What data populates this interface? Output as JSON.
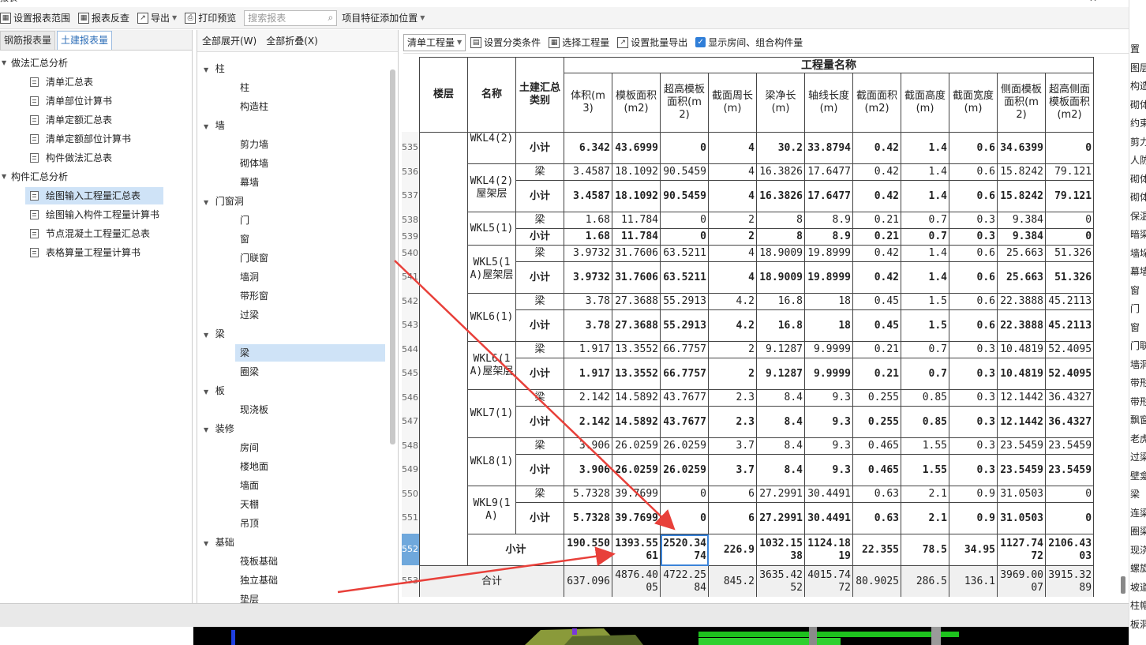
{
  "window": {
    "title": "报表",
    "close_glyph": "✕"
  },
  "toolbar": {
    "items": [
      "设置报表范围",
      "报表反查",
      "导出",
      "打印预览"
    ],
    "search_placeholder": "搜索报表",
    "item_after_search": "项目特征添加位置"
  },
  "left_panel": {
    "tabs": [
      "钢筋报表量",
      "土建报表量"
    ],
    "active_tab": 1,
    "groups": [
      {
        "label": "做法汇总分析",
        "items": [
          "清单汇总表",
          "清单部位计算书",
          "清单定额汇总表",
          "清单定额部位计算书",
          "构件做法汇总表"
        ]
      },
      {
        "label": "构件汇总分析",
        "items": [
          "绘图输入工程量汇总表",
          "绘图输入构件工程量计算书",
          "节点混凝土工程量汇总表",
          "表格算量工程量计算书"
        ]
      }
    ],
    "selected_item": "绘图输入工程量汇总表"
  },
  "mid_panel": {
    "expand_all": "全部展开(W)",
    "collapse_all": "全部折叠(X)",
    "tree": [
      {
        "label": "柱",
        "children": [
          "柱",
          "构造柱"
        ]
      },
      {
        "label": "墙",
        "children": [
          "剪力墙",
          "砌体墙",
          "幕墙"
        ]
      },
      {
        "label": "门窗洞",
        "children": [
          "门",
          "窗",
          "门联窗",
          "墙洞",
          "带形窗",
          "过梁"
        ]
      },
      {
        "label": "梁",
        "children": [
          "梁",
          "圈梁"
        ]
      },
      {
        "label": "板",
        "children": [
          "现浇板"
        ]
      },
      {
        "label": "装修",
        "children": [
          "房间",
          "楼地面",
          "墙面",
          "天棚",
          "吊顶"
        ]
      },
      {
        "label": "基础",
        "children": [
          "筏板基础",
          "独立基础",
          "垫层"
        ]
      }
    ],
    "selected": "梁"
  },
  "report_toolbar": {
    "mode_select": "清单工程量",
    "buttons": [
      "设置分类条件",
      "选择工程量",
      "设置批量导出"
    ],
    "checkbox_label": "显示房间、组合构件量",
    "checkbox_checked": true
  },
  "table": {
    "group_header": "工程量名称",
    "fixed_headers": [
      "楼层",
      "名称",
      "土建汇总类别"
    ],
    "columns": [
      "体积(m3)",
      "模板面积(m2)",
      "超高模板面积(m2)",
      "截面周长(m)",
      "梁净长(m)",
      "轴线长度(m)",
      "截面面积(m2)",
      "截面高度(m)",
      "截面宽度(m)",
      "侧面模板面积(m2)",
      "超高侧面模板面积(m2)"
    ],
    "rows": [
      {
        "num": "535",
        "name": "WKL4(2)",
        "cat": "小计",
        "bold": true,
        "v": [
          "6.342",
          "43.6999",
          "0",
          "4",
          "30.2",
          "33.8794",
          "0.42",
          "1.4",
          "0.6",
          "34.6399",
          "0"
        ]
      },
      {
        "num": "536",
        "name": "WKL4(2)屋架层",
        "cat": "梁",
        "bold": false,
        "v": [
          "3.4587",
          "18.1092",
          "90.5459",
          "4",
          "16.3826",
          "17.6477",
          "0.42",
          "1.4",
          "0.6",
          "15.8242",
          "79.121"
        ]
      },
      {
        "num": "537",
        "name": "",
        "cat": "小计",
        "bold": true,
        "v": [
          "3.4587",
          "18.1092",
          "90.5459",
          "4",
          "16.3826",
          "17.6477",
          "0.42",
          "1.4",
          "0.6",
          "15.8242",
          "79.121"
        ]
      },
      {
        "num": "538",
        "name": "WKL5(1)",
        "cat": "梁",
        "bold": false,
        "v": [
          "1.68",
          "11.784",
          "0",
          "2",
          "8",
          "8.9",
          "0.21",
          "0.7",
          "0.3",
          "9.384",
          "0"
        ]
      },
      {
        "num": "539",
        "name": "",
        "cat": "小计",
        "bold": true,
        "v": [
          "1.68",
          "11.784",
          "0",
          "2",
          "8",
          "8.9",
          "0.21",
          "0.7",
          "0.3",
          "9.384",
          "0"
        ]
      },
      {
        "num": "540",
        "name": "WKL5(1A)屋架层",
        "cat": "梁",
        "bold": false,
        "v": [
          "3.9732",
          "31.7606",
          "63.5211",
          "4",
          "18.9009",
          "19.8999",
          "0.42",
          "1.4",
          "0.6",
          "25.663",
          "51.326"
        ]
      },
      {
        "num": "541",
        "name": "",
        "cat": "小计",
        "bold": true,
        "v": [
          "3.9732",
          "31.7606",
          "63.5211",
          "4",
          "18.9009",
          "19.8999",
          "0.42",
          "1.4",
          "0.6",
          "25.663",
          "51.326"
        ]
      },
      {
        "num": "542",
        "name": "WKL6(1)",
        "cat": "梁",
        "bold": false,
        "v": [
          "3.78",
          "27.3688",
          "55.2913",
          "4.2",
          "16.8",
          "18",
          "0.45",
          "1.5",
          "0.6",
          "22.3888",
          "45.2113"
        ]
      },
      {
        "num": "543",
        "name": "",
        "cat": "小计",
        "bold": true,
        "v": [
          "3.78",
          "27.3688",
          "55.2913",
          "4.2",
          "16.8",
          "18",
          "0.45",
          "1.5",
          "0.6",
          "22.3888",
          "45.2113"
        ]
      },
      {
        "num": "544",
        "name": "WKL6(1A)屋架层",
        "cat": "梁",
        "bold": false,
        "v": [
          "1.917",
          "13.3552",
          "66.7757",
          "2",
          "9.1287",
          "9.9999",
          "0.21",
          "0.7",
          "0.3",
          "10.4819",
          "52.4095"
        ]
      },
      {
        "num": "545",
        "name": "",
        "cat": "小计",
        "bold": true,
        "v": [
          "1.917",
          "13.3552",
          "66.7757",
          "2",
          "9.1287",
          "9.9999",
          "0.21",
          "0.7",
          "0.3",
          "10.4819",
          "52.4095"
        ]
      },
      {
        "num": "546",
        "name": "WKL7(1)",
        "cat": "梁",
        "bold": false,
        "v": [
          "2.142",
          "14.5892",
          "43.7677",
          "2.3",
          "8.4",
          "9.3",
          "0.255",
          "0.85",
          "0.3",
          "12.1442",
          "36.4327"
        ]
      },
      {
        "num": "547",
        "name": "",
        "cat": "小计",
        "bold": true,
        "v": [
          "2.142",
          "14.5892",
          "43.7677",
          "2.3",
          "8.4",
          "9.3",
          "0.255",
          "0.85",
          "0.3",
          "12.1442",
          "36.4327"
        ]
      },
      {
        "num": "548",
        "name": "WKL8(1)",
        "cat": "梁",
        "bold": false,
        "v": [
          "3.906",
          "26.0259",
          "26.0259",
          "3.7",
          "8.4",
          "9.3",
          "0.465",
          "1.55",
          "0.3",
          "23.5459",
          "23.5459"
        ]
      },
      {
        "num": "549",
        "name": "",
        "cat": "小计",
        "bold": true,
        "v": [
          "3.906",
          "26.0259",
          "26.0259",
          "3.7",
          "8.4",
          "9.3",
          "0.465",
          "1.55",
          "0.3",
          "23.5459",
          "23.5459"
        ]
      },
      {
        "num": "550",
        "name": "WKL9(1A)",
        "cat": "梁",
        "bold": false,
        "v": [
          "5.7328",
          "39.7699",
          "0",
          "6",
          "27.2991",
          "30.4491",
          "0.63",
          "2.1",
          "0.9",
          "31.0503",
          "0"
        ]
      },
      {
        "num": "551",
        "name": "",
        "cat": "小计",
        "bold": true,
        "v": [
          "5.7328",
          "39.7699",
          "0",
          "6",
          "27.2991",
          "30.4491",
          "0.63",
          "2.1",
          "0.9",
          "31.0503",
          "0"
        ]
      }
    ],
    "subtotal": {
      "num": "552",
      "label": "小计",
      "v": [
        "190.5509",
        "1393.5561",
        "2520.3474",
        "226.9",
        "1032.1538",
        "1124.1819",
        "22.355",
        "78.5",
        "34.95",
        "1127.7472",
        "2106.4303"
      ]
    },
    "total": {
      "num": "553",
      "label": "合计",
      "v": [
        "637.096",
        "4876.4005",
        "4722.2584",
        "845.2",
        "3635.4252",
        "4015.7472",
        "80.9025",
        "286.5",
        "136.1",
        "3969.0007",
        "3915.3289"
      ]
    }
  },
  "right_strip": [
    "置",
    "图层",
    "构造",
    "砌体",
    "约束",
    "剪力",
    "人防",
    "砌体",
    "砌体",
    "保温",
    "暗梁",
    "墙垛",
    "幕墙",
    "窗",
    "门",
    "窗",
    "门联",
    "墙洞",
    "带形",
    "带形",
    "飘窗",
    "老虎",
    "过梁",
    "壁龛",
    "梁",
    "连梁",
    "圈梁",
    "现浇",
    "螺旋",
    "坡道",
    "柱帽",
    "板洞"
  ],
  "colors": {
    "accent": "#2f7ed8",
    "selection": "#cfe3f7",
    "arrow": "#e8403a"
  }
}
